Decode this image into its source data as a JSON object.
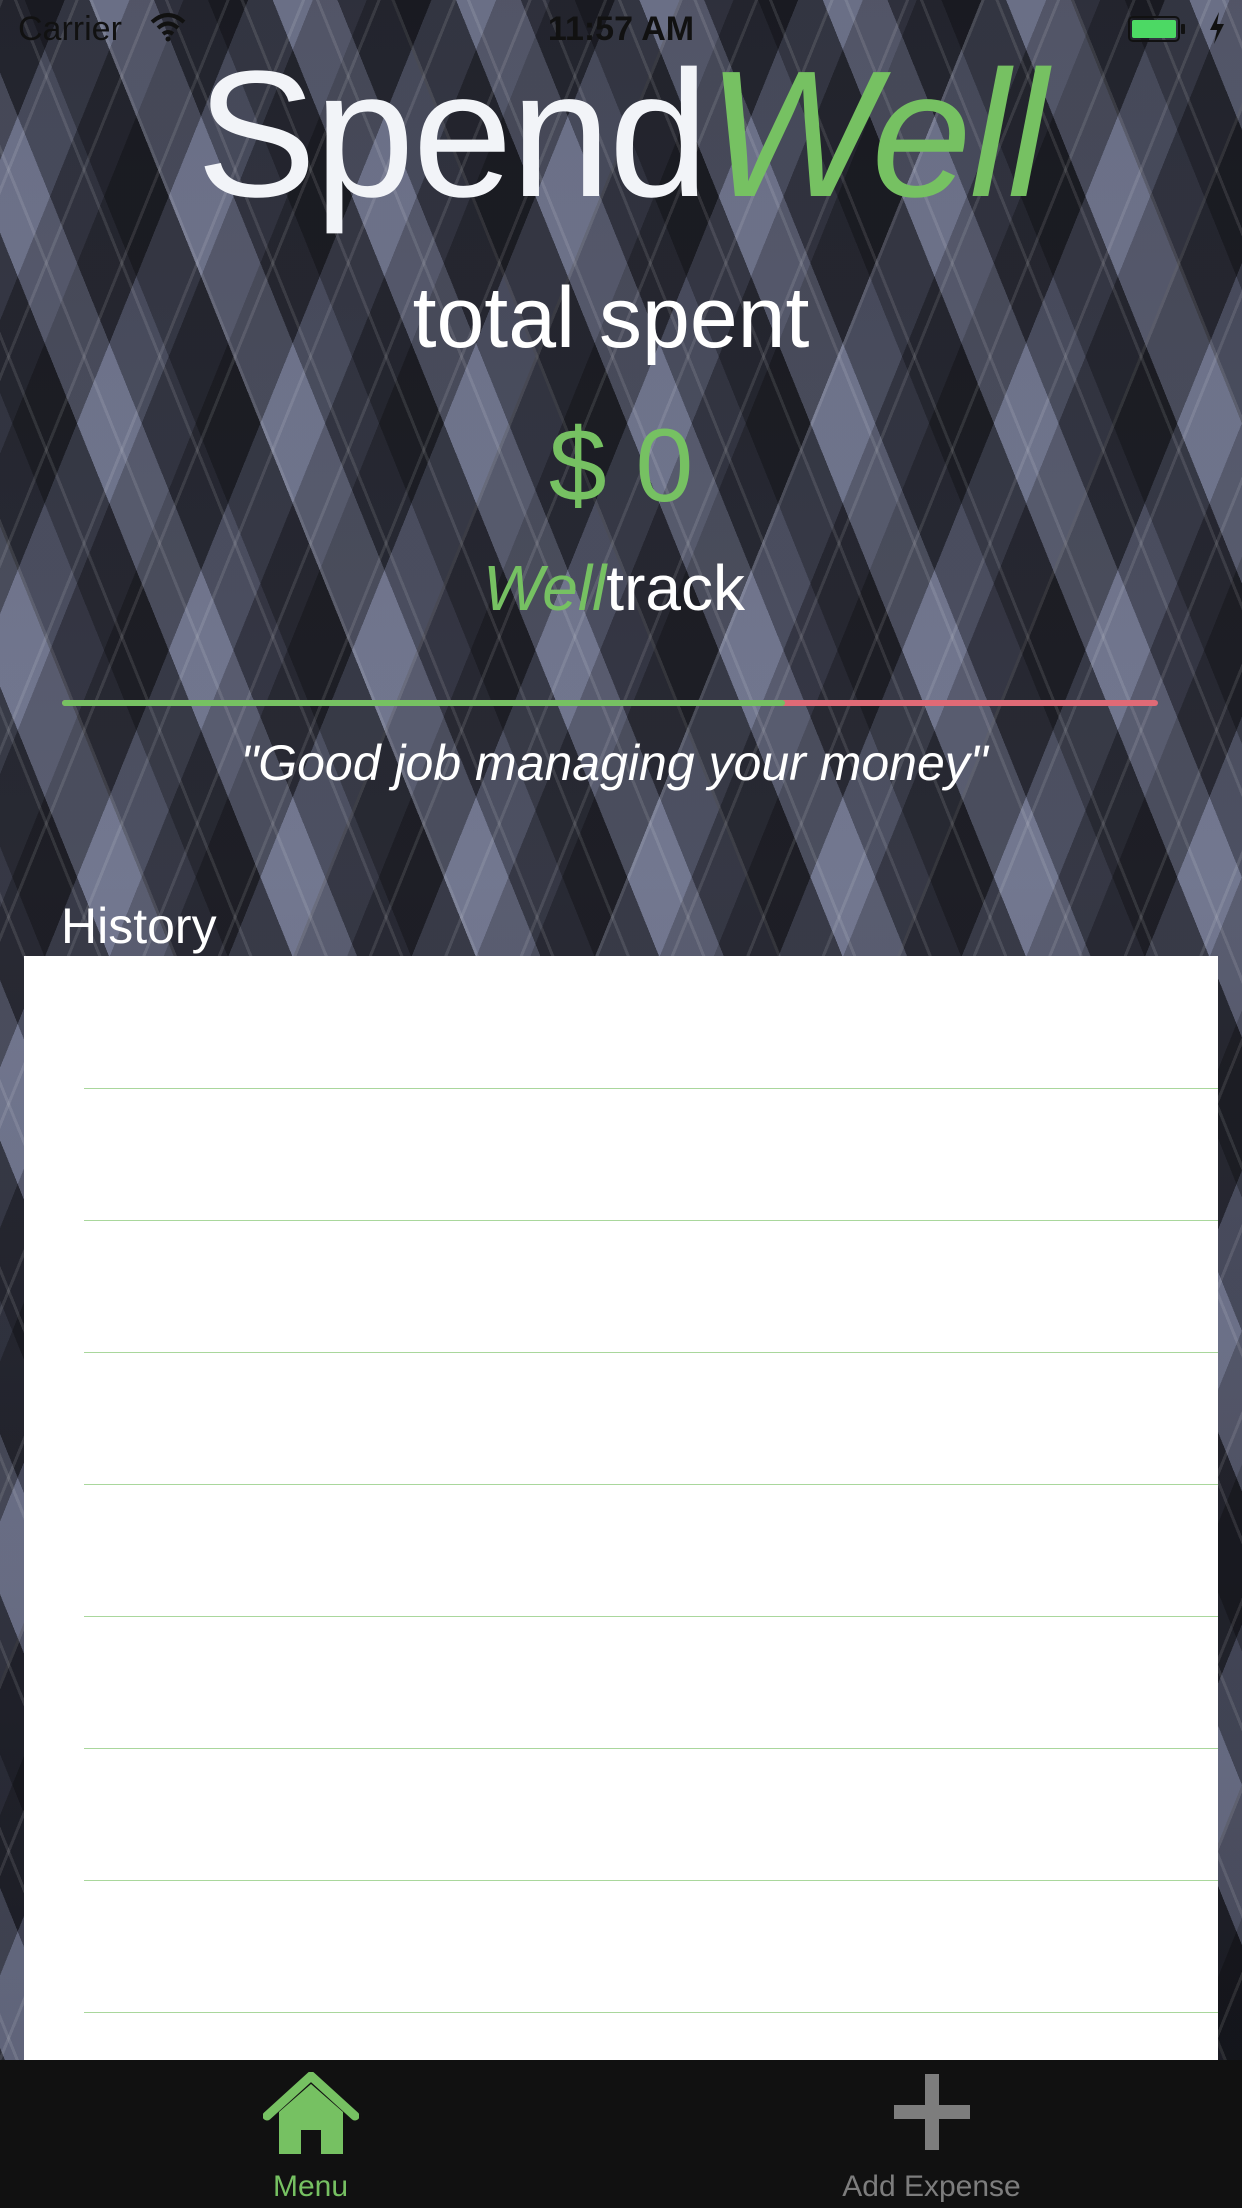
{
  "status_bar": {
    "carrier": "Carrier",
    "time": "11:57 AM",
    "wifi_icon": "wifi-icon",
    "battery_icon": "battery-icon",
    "charging_icon": "bolt-icon",
    "battery_color": "#4cd964"
  },
  "header": {
    "title_plain": "Spend",
    "title_accent": "Well"
  },
  "summary": {
    "label": "total spent",
    "amount": "$ 0"
  },
  "meter": {
    "title_accent": "Well",
    "title_plain": "track",
    "good_fraction": 0.66,
    "good_color": "#76c162",
    "bad_color": "#e06a76"
  },
  "quote": "\"Good job managing your money\"",
  "history": {
    "label": "History",
    "divider_color": "#a9d79c",
    "rows": [
      "",
      "",
      "",
      "",
      "",
      "",
      "",
      "",
      ""
    ]
  },
  "tab_bar": {
    "items": [
      {
        "label": "Menu",
        "icon": "home-icon",
        "active": true,
        "color": "#76c162"
      },
      {
        "label": "Add Expense",
        "icon": "plus-icon",
        "active": false,
        "color": "#7d7d7d"
      }
    ]
  }
}
